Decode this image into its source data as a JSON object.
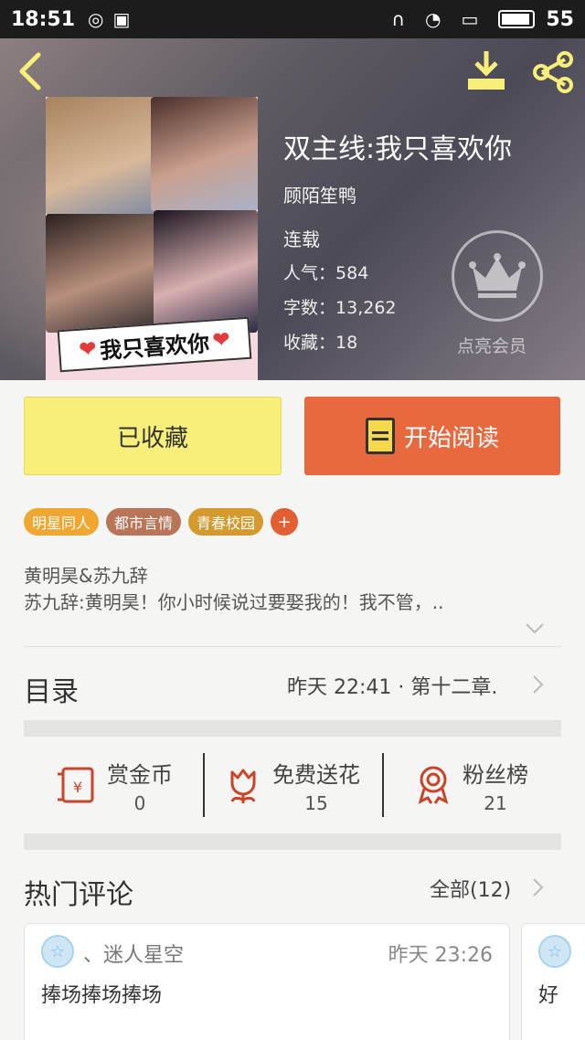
{
  "status_bar": {
    "time": "18:51",
    "battery": "55"
  },
  "book": {
    "title": "双主线:我只喜欢你",
    "author": "顾陌笙鸭",
    "status": "连载",
    "popularity_label": "人气：",
    "popularity": "584",
    "words_label": "字数：",
    "words": "13,262",
    "favorites_label": "收藏：",
    "favorites": "18",
    "cover_text": "我只喜欢你",
    "vip_label": "点亮会员"
  },
  "actions": {
    "fav_label": "已收藏",
    "read_label": "开始阅读"
  },
  "tags": [
    {
      "label": "明星同人",
      "color": "#f0a732"
    },
    {
      "label": "都市言情",
      "color": "#b87558"
    },
    {
      "label": "青春校园",
      "color": "#d49a2e"
    }
  ],
  "tag_add": "+",
  "description": {
    "line1": "黄明昊&苏九辞",
    "line2": "苏九辞:黄明昊！你小时候说过要娶我的！我不管，.."
  },
  "toc": {
    "title": "目录",
    "latest": "昨天 22:41 · 第十二章."
  },
  "stats": [
    {
      "label": "赏金币",
      "value": "0",
      "icon": "red-envelope-icon"
    },
    {
      "label": "免费送花",
      "value": "15",
      "icon": "flower-icon"
    },
    {
      "label": "粉丝榜",
      "value": "21",
      "icon": "award-badge-icon"
    }
  ],
  "hot_comments": {
    "title": "热门评论",
    "all_label": "全部(12)",
    "comments": [
      {
        "user": "、迷人星空",
        "time": "昨天 23:26",
        "text": "捧场捧场捧场"
      },
      {
        "user": "",
        "time": "",
        "text": "好"
      }
    ]
  },
  "colors": {
    "fav_bg": "#f7ef79",
    "read_bg": "#e9693f",
    "accent_icon": "#c8442a"
  }
}
